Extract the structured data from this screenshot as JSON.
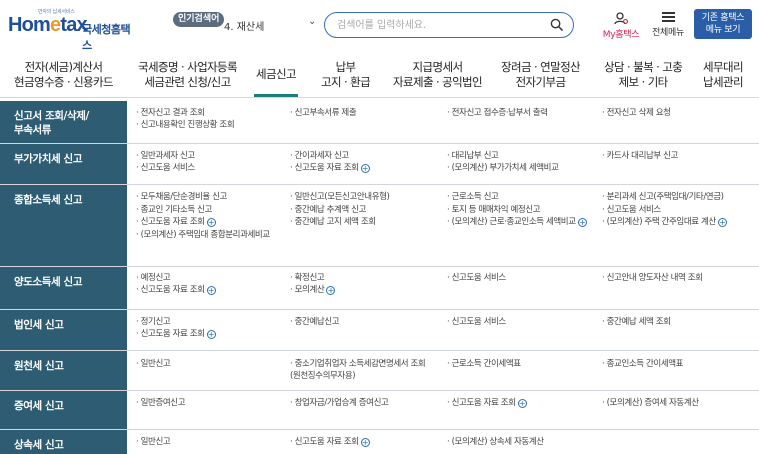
{
  "header": {
    "logo_slogan": "만자의 납세서비스",
    "logo_brand_a": "Hom",
    "logo_brand_e": "e",
    "logo_brand_b": "tax",
    "logo_sub": "국세청홈택스",
    "popular_badge": "인기검색어",
    "popular_item": "4. 재산세",
    "search_placeholder": "검색어를 입력하세요.",
    "myhome_label": "My홈택스",
    "allmenu_label": "전체메뉴",
    "old_hometax_line1": "기존 홈택스",
    "old_hometax_line2": "메뉴 보기"
  },
  "nav": [
    {
      "l1": "전자(세금)계산서",
      "l2": "현금영수증 · 신용카드"
    },
    {
      "l1": "국세증명 · 사업자등록",
      "l2": "세금관련 신청/신고"
    },
    {
      "l1": "세금신고",
      "l2": ""
    },
    {
      "l1": "납부",
      "l2": "고지 · 환급"
    },
    {
      "l1": "지급명세서",
      "l2": "자료제출 · 공익법인"
    },
    {
      "l1": "장려금 · 연말정산",
      "l2": "전자기부금"
    },
    {
      "l1": "상담 · 불복 · 고충",
      "l2": "제보 · 기타"
    },
    {
      "l1": "세무대리",
      "l2": "납세관리"
    }
  ],
  "rows": [
    {
      "cat": [
        "신고서 조회/삭제/",
        "부속서류"
      ],
      "cells": [
        [
          {
            "t": "· 전자신고 결과 조회",
            "p": false
          },
          {
            "t": "· 신고내용확인 진행상황 조회",
            "p": false
          }
        ],
        [
          {
            "t": "· 신고부속서류 제출",
            "p": false
          }
        ],
        [
          {
            "t": "· 전자신고 접수증·납부서 출력",
            "p": false
          }
        ],
        [
          {
            "t": "· 전자신고 삭제 요청",
            "p": false
          }
        ]
      ]
    },
    {
      "cat": [
        "부가가치세 신고"
      ],
      "cells": [
        [
          {
            "t": "· 일반과세자 신고",
            "p": false
          },
          {
            "t": "· 신고도움 서비스",
            "p": false
          }
        ],
        [
          {
            "t": "· 간이과세자 신고",
            "p": false
          },
          {
            "t": "· 신고도움 자료 조회",
            "p": true
          }
        ],
        [
          {
            "t": "· 대리납부 신고",
            "p": false
          },
          {
            "t": "· (모의계산) 부가가치세 세액비교",
            "p": false
          }
        ],
        [
          {
            "t": "· 카드사 대리납부 신고",
            "p": false
          }
        ]
      ]
    },
    {
      "cat": [
        "종합소득세 신고"
      ],
      "cells": [
        [
          {
            "t": "· 모두채움/단순경비율 신고",
            "p": false
          },
          {
            "t": "· 종교인 기타소득 신고",
            "p": false
          },
          {
            "t": "· 신고도움 자료 조회",
            "p": true
          },
          {
            "t": "· (모의계산) 주택임대 종합분리과세비교",
            "p": false
          }
        ],
        [
          {
            "t": "· 일반신고(모든신고안내유형)",
            "p": false
          },
          {
            "t": "· 중간예납 추계액 신고",
            "p": false
          },
          {
            "t": "· 중간예납 고지 세액 조회",
            "p": false
          }
        ],
        [
          {
            "t": "· 근로소득 신고",
            "p": false
          },
          {
            "t": "· 토지 등 매매차익 예정신고",
            "p": false
          },
          {
            "t": "· (모의계산) 근로·종교인소득 세액비교",
            "p": true
          }
        ],
        [
          {
            "t": "· 분리과세 신고(주택임대/기타/연금)",
            "p": false
          },
          {
            "t": "· 신고도움 서비스",
            "p": false
          },
          {
            "t": "· (모의계산) 주택 간주임대료 계산",
            "p": true
          }
        ]
      ]
    },
    {
      "cat": [
        "양도소득세 신고"
      ],
      "cells": [
        [
          {
            "t": "· 예정신고",
            "p": false
          },
          {
            "t": "· 신고도움 자료 조회",
            "p": true
          }
        ],
        [
          {
            "t": "· 확정신고",
            "p": false
          },
          {
            "t": "· 모의계산",
            "p": true
          }
        ],
        [
          {
            "t": "· 신고도움 서비스",
            "p": false
          }
        ],
        [
          {
            "t": "· 신고안내 양도자산 내역 조회",
            "p": false
          }
        ]
      ]
    },
    {
      "cat": [
        "법인세 신고"
      ],
      "cells": [
        [
          {
            "t": "· 정기신고",
            "p": false
          },
          {
            "t": "· 신고도움 자료 조회",
            "p": true
          }
        ],
        [
          {
            "t": "· 중간예납신고",
            "p": false
          }
        ],
        [
          {
            "t": "· 신고도움 서비스",
            "p": false
          }
        ],
        [
          {
            "t": "· 중간예납 세액 조회",
            "p": false
          }
        ]
      ]
    },
    {
      "cat": [
        "원천세 신고"
      ],
      "cells": [
        [
          {
            "t": "· 일반신고",
            "p": false
          }
        ],
        [
          {
            "t": "· 중소기업취업자 소득세감면명세서 조회",
            "p": false
          },
          {
            "t": "  (원천징수의무자용)",
            "p": false
          }
        ],
        [
          {
            "t": "· 근로소득 간이세액표",
            "p": false
          }
        ],
        [
          {
            "t": "· 종교인소득 간이세액표",
            "p": false
          }
        ]
      ]
    },
    {
      "cat": [
        "증여세 신고"
      ],
      "cells": [
        [
          {
            "t": "· 일반증여신고",
            "p": false
          }
        ],
        [
          {
            "t": "· 창업자금/가업승계 증여신고",
            "p": false
          }
        ],
        [
          {
            "t": "· 신고도움 자료 조회",
            "p": true
          }
        ],
        [
          {
            "t": "· (모의계산) 증여세 자동계산",
            "p": false
          }
        ]
      ]
    },
    {
      "cat": [
        "상속세 신고"
      ],
      "cells": [
        [
          {
            "t": "· 일반신고",
            "p": false
          }
        ],
        [
          {
            "t": "· 신고도움 자료 조회",
            "p": true
          }
        ],
        [
          {
            "t": "· (모의계산) 상속세 자동계산",
            "p": false
          }
        ],
        []
      ]
    }
  ]
}
